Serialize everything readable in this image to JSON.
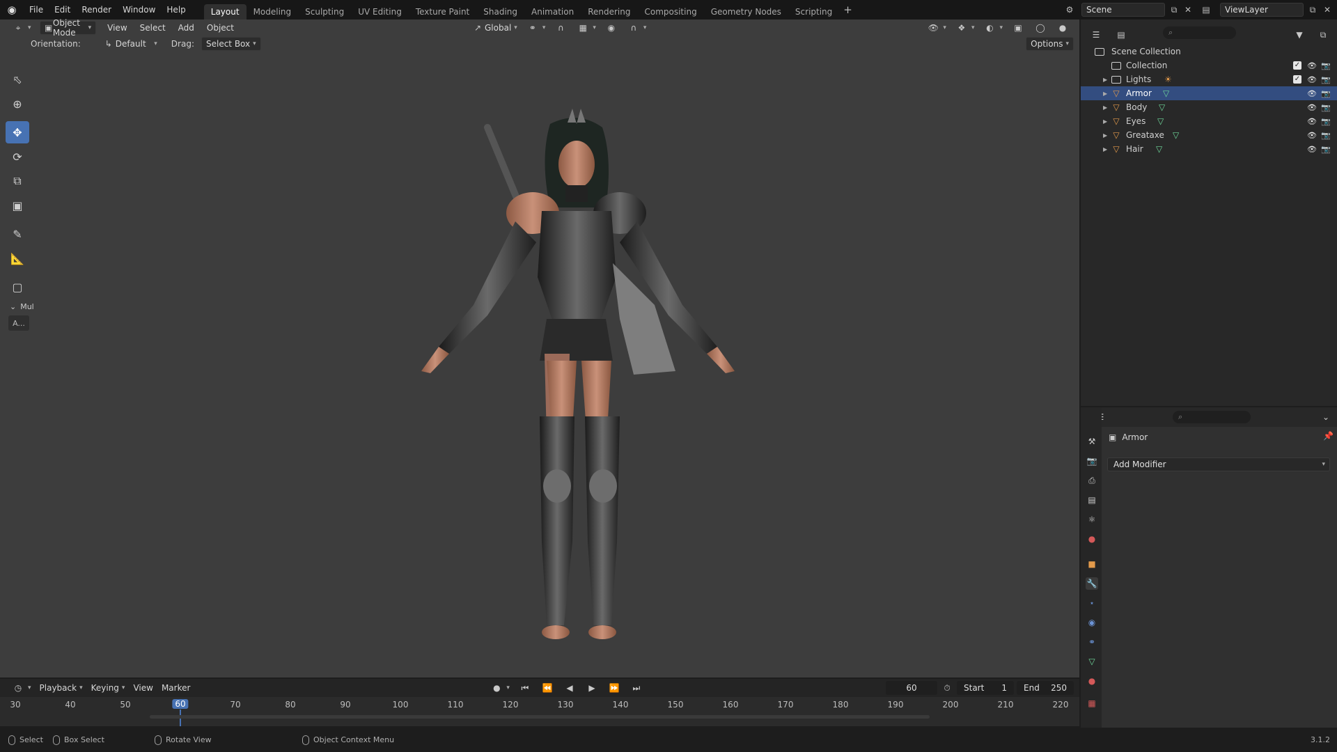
{
  "topbar": {
    "menus": [
      "File",
      "Edit",
      "Render",
      "Window",
      "Help"
    ],
    "workspaces": [
      "Layout",
      "Modeling",
      "Sculpting",
      "UV Editing",
      "Texture Paint",
      "Shading",
      "Animation",
      "Rendering",
      "Compositing",
      "Geometry Nodes",
      "Scripting"
    ],
    "active_workspace": "Layout",
    "add_tab": "+",
    "scene": "Scene",
    "view_layer": "ViewLayer"
  },
  "viewport": {
    "mode": "Object Mode",
    "menus": [
      "View",
      "Select",
      "Add",
      "Object"
    ],
    "transform_orientation": "Global",
    "orientation_label": "Orientation:",
    "orientation_value": "Default",
    "drag_label": "Drag:",
    "drag_value": "Select Box",
    "options": "Options",
    "tool_panel_label": "Mul",
    "tool_panel_button": "A..."
  },
  "outliner": {
    "root": "Scene Collection",
    "rows": [
      {
        "name": "Collection",
        "level": 1,
        "kind": "collection"
      },
      {
        "name": "Lights",
        "level": 1,
        "kind": "collection"
      },
      {
        "name": "Armor",
        "level": 1,
        "kind": "object",
        "selected": true
      },
      {
        "name": "Body",
        "level": 1,
        "kind": "object"
      },
      {
        "name": "Eyes",
        "level": 1,
        "kind": "object"
      },
      {
        "name": "Greataxe",
        "level": 1,
        "kind": "object"
      },
      {
        "name": "Hair",
        "level": 1,
        "kind": "object"
      }
    ]
  },
  "properties": {
    "object_name": "Armor",
    "add_modifier": "Add Modifier"
  },
  "timeline": {
    "menus": [
      "Playback",
      "Keying",
      "View",
      "Marker"
    ],
    "current_frame": "60",
    "start_label": "Start",
    "start": "1",
    "end_label": "End",
    "end": "250",
    "ticks": [
      "30",
      "40",
      "50",
      "60",
      "70",
      "80",
      "90",
      "100",
      "110",
      "120",
      "130",
      "140",
      "150",
      "160",
      "170",
      "180",
      "190",
      "200",
      "210",
      "220"
    ]
  },
  "statusbar": {
    "select": "Select",
    "box_select": "Box Select",
    "rotate_view": "Rotate View",
    "context_menu": "Object Context Menu",
    "version": "3.1.2"
  },
  "colors": {
    "accent": "#4772b3",
    "selected_row": "#334d80",
    "object_icon": "#e39a4b",
    "mesh_icon": "#6fd89b"
  }
}
